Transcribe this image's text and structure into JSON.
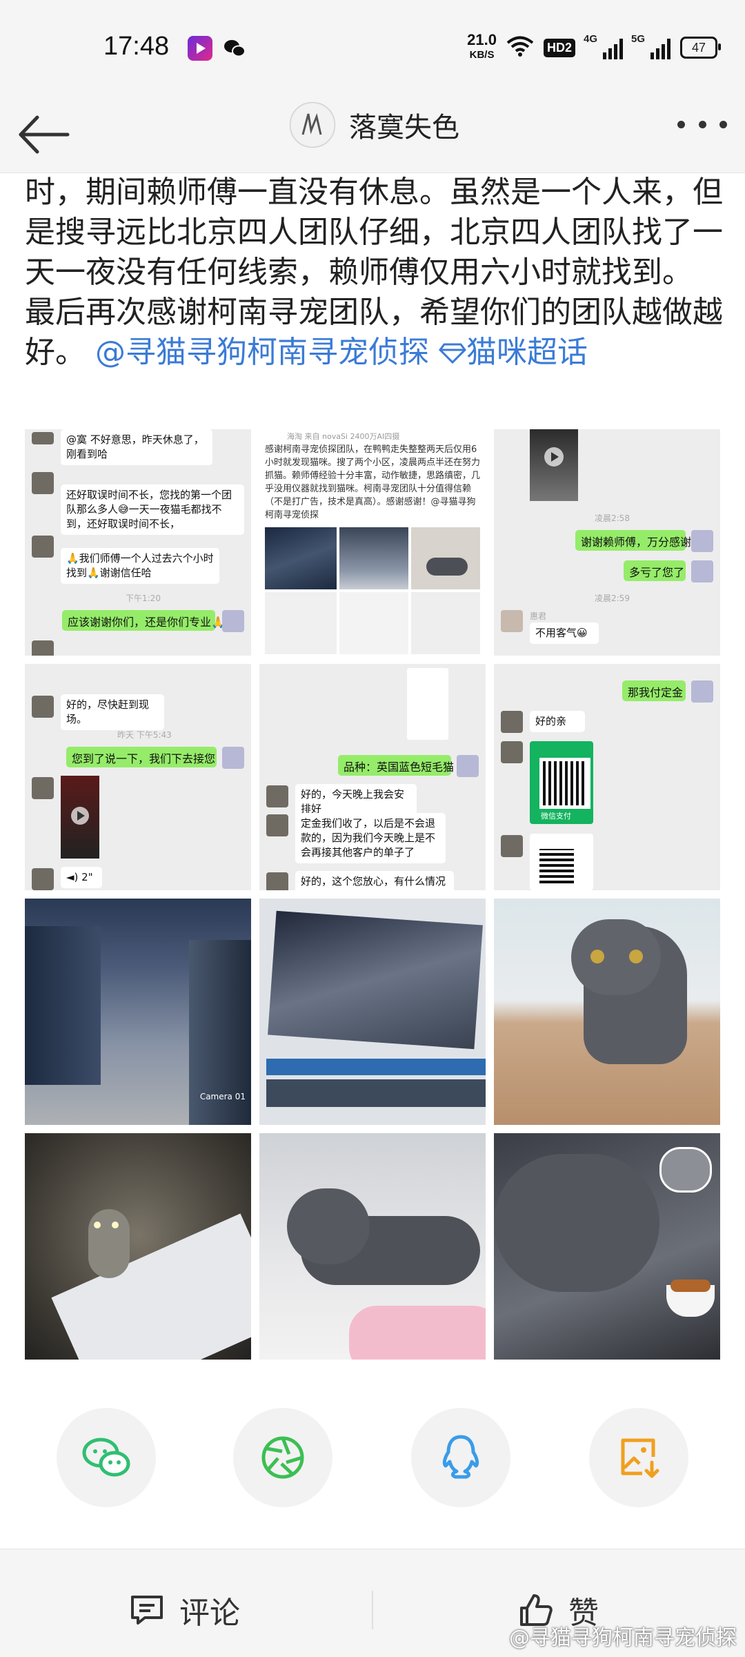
{
  "status": {
    "time": "17:48",
    "net_speed_value": "21.0",
    "net_speed_unit": "KB/S",
    "hd_label": "HD2",
    "signal1_label": "4G",
    "signal2_label": "5G",
    "battery": "47"
  },
  "nav": {
    "title": "落寞失色"
  },
  "post": {
    "text": "时，期间赖师傅一直没有休息。虽然是一个人来，但是搜寻远比北京四人团队仔细，北京四人团队找了一天一夜没有任何线索，赖师傅仅用六小时就找到。\n最后再次感谢柯南寻宠团队，希望你们的团队越做越好。",
    "mention": "@寻猫寻狗柯南寻宠侦探",
    "topic": "猫咪超话"
  },
  "images": {
    "chat1": {
      "msg1": "@寞 不好意思，昨天休息了，刚看到哈",
      "msg2": "还好取误时间不长，您找的第一个团队那么多人😅一天一夜猫毛都找不到，还好取误时间不长，",
      "msg3": "🙏我们师傅一个人过去六个小时找到🙏谢谢信任哈",
      "time": "下午1:20",
      "msg4": "应该谢谢你们，还是你们专业🙏"
    },
    "post_card": {
      "header": "海淘 来自 novaSi 2400万AI四摄",
      "text": "感谢柯南寻宠侦探团队，在鸭鸭走失整整两天后仅用6小时就发现猫咪。搜了两个小区，凌晨两点半还在努力抓猫。赖师傅经验十分丰富，动作敏捷，思路缜密，几乎没用仪器就找到猫咪。柯南寻宠团队十分值得信赖（不是打广告，技术是真高）。感谢感谢！@寻猫寻狗柯南寻宠侦探"
    },
    "chat3": {
      "time1": "凌晨2:58",
      "msg1": "谢谢赖师傅，万分感谢",
      "msg2": "多亏了您了",
      "time2": "凌晨2:59",
      "name": "惠君",
      "msg3": "不用客气😀"
    },
    "chat4": {
      "msg1": "好的，尽快赶到现场。",
      "time": "昨天 下午5:43",
      "msg2": "您到了说一下，我们下去接您",
      "voice": "2\""
    },
    "chat5": {
      "msg1": "品种：英国蓝色短毛猫",
      "msg2": "好的，今天晚上我会安排好",
      "msg3": "定金我们收了，以后是不会退款的，因为我们今天晚上是不会再接其他客户的单子了",
      "msg4": "好的，这个您放心，有什么情况随"
    },
    "chat6": {
      "msg1": "那我付定金",
      "msg2": "好的亲",
      "pay_label": "微信支付"
    },
    "camera_label": "Camera 01"
  },
  "share": {
    "items": [
      "wechat",
      "moments",
      "qq",
      "save-image"
    ]
  },
  "bottom": {
    "comment": "评论",
    "like": "赞",
    "watermark": "@寻猫寻狗柯南寻宠侦探"
  },
  "colors": {
    "link": "#3b7bd6",
    "wechat_green": "#2fbf71",
    "qq_blue": "#3a9ce8",
    "save_orange": "#f0a020",
    "chat_green": "#95ec69"
  }
}
